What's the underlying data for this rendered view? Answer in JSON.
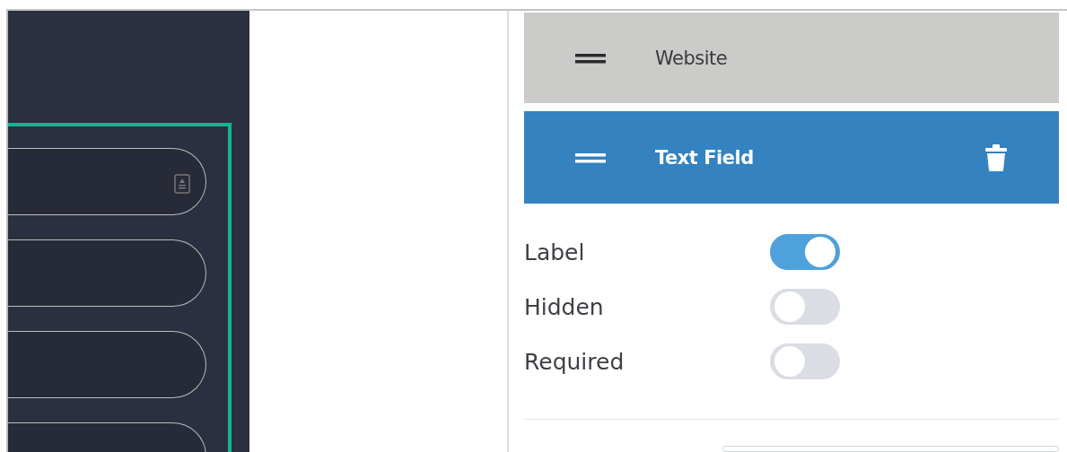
{
  "fields": [
    {
      "label": "Website",
      "selected": false
    },
    {
      "label": "Text Field",
      "selected": true
    }
  ],
  "options": [
    {
      "label": "Label",
      "on": true
    },
    {
      "label": "Hidden",
      "on": false
    },
    {
      "label": "Required",
      "on": false
    }
  ]
}
